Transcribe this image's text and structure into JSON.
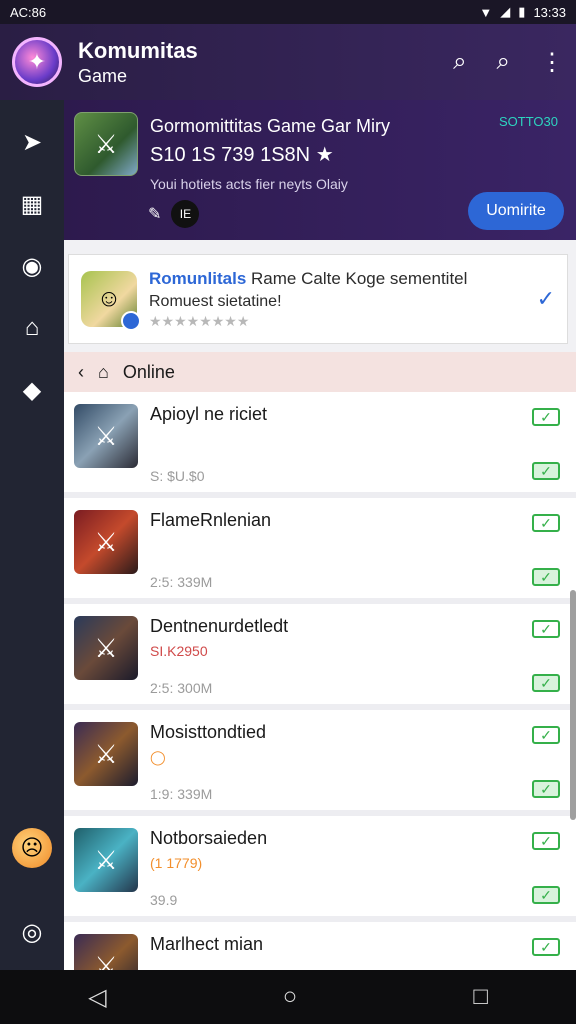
{
  "statusbar": {
    "left": "AC:86",
    "right": "13:33",
    "icons": [
      "wifi-icon",
      "signal-icon",
      "battery-icon"
    ]
  },
  "header": {
    "title": "Komumitas",
    "subtitle": "Game"
  },
  "sidebar": {
    "items": [
      "send-icon",
      "calendar-icon",
      "gamepad-icon",
      "home-icon",
      "tag-icon"
    ],
    "bottom": [
      "emoji-face-icon",
      "profile-icon"
    ]
  },
  "banner": {
    "title": "Gormomittitas Game Gar Miry",
    "count": "S10 1S 739 1S8N",
    "desc": "Youi hotiets acts fier neyts Olaiy",
    "tag": "SOTTO30",
    "mini": "IE",
    "button": "Uomirite"
  },
  "notice": {
    "title_highlight": "Romunlitals",
    "title_rest": " Rame Calte Koge sementitel",
    "subtitle": "Romuest sietatine!",
    "rating": "★★★★★★★★"
  },
  "online": {
    "label": "Online"
  },
  "list": [
    {
      "name": "Apioyl ne riciet",
      "sub": "",
      "meta": "S: $U.$0"
    },
    {
      "name": "FlameRnlenian",
      "sub": "",
      "meta": "2:5: 339M"
    },
    {
      "name": "Dentnenurdetledt",
      "sub": "SI.K2950",
      "meta": "2:5: 300M"
    },
    {
      "name": "Mosisttondtied",
      "sub": "◯",
      "meta": "1:9: 339M"
    },
    {
      "name": "Notborsaieden",
      "sub": "(1 1779)",
      "meta": "39.9"
    },
    {
      "name": "Marlhect mian",
      "sub": "",
      "meta": ""
    }
  ]
}
